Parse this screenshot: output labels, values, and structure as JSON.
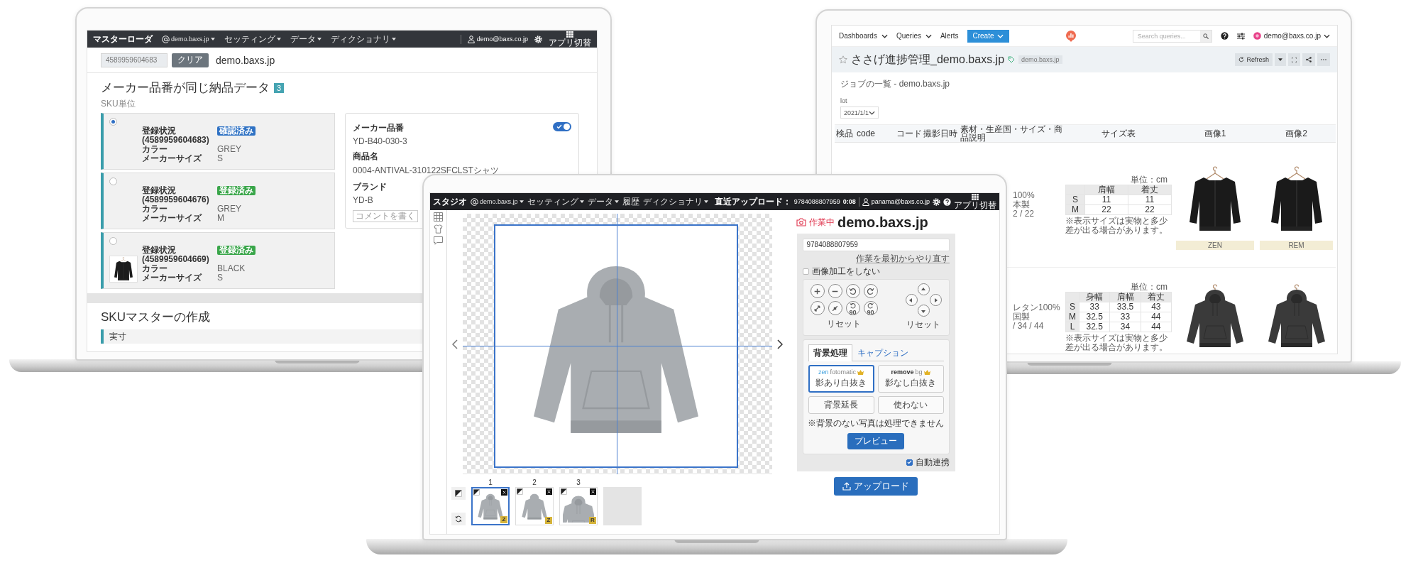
{
  "left_laptop": {
    "nav": {
      "app_name": "マスターローダ",
      "menus": [
        {
          "label": "demo.baxs.jp",
          "kind": "domain"
        },
        {
          "label": "セッティング",
          "kind": "menu"
        },
        {
          "label": "データ",
          "kind": "menu"
        },
        {
          "label": "ディクショナリ",
          "kind": "menu"
        }
      ],
      "user": "demo@baxs.co.jp",
      "apps_label": "アプリ切替"
    },
    "search": {
      "value": "4589959604683",
      "clear_button": "クリア",
      "domain": "demo.baxs.jp"
    },
    "heading": "メーカー品番が同じ納品データ",
    "count": "3",
    "subheading": "SKU単位",
    "sku_cards": [
      {
        "selected": true,
        "photo": false,
        "status_label": "登録状況",
        "code": "(4589959604683)",
        "badge": {
          "text": "確認済み",
          "color": "#2f72c4"
        },
        "attributes": [
          {
            "label": "カラー",
            "value": "GREY"
          },
          {
            "label": "メーカーサイズ",
            "value": "S"
          }
        ]
      },
      {
        "selected": false,
        "photo": false,
        "status_label": "登録状況",
        "code": "(4589959604676)",
        "badge": {
          "text": "登録済み",
          "color": "#3aa64a"
        },
        "attributes": [
          {
            "label": "カラー",
            "value": "GREY"
          },
          {
            "label": "メーカーサイズ",
            "value": "M"
          }
        ]
      },
      {
        "selected": false,
        "photo": true,
        "status_label": "登録状況",
        "code": "(4589959604669)",
        "badge": {
          "text": "登録済み",
          "color": "#3aa64a"
        },
        "attributes": [
          {
            "label": "カラー",
            "value": "BLACK"
          },
          {
            "label": "メーカーサイズ",
            "value": "S"
          }
        ]
      }
    ],
    "detail": {
      "fields": [
        {
          "label": "メーカー品番",
          "value": "YD-B40-030-3"
        },
        {
          "label": "商品名",
          "value": "0004-ANTIVAL-310122SFCLSTシャツ"
        },
        {
          "label": "ブランド",
          "value": "YD-B"
        }
      ],
      "toggle_on": true,
      "comment_placeholder": "コメントを書く"
    },
    "section_title": "SKUマスターの作成",
    "panel_title": "実寸"
  },
  "center_laptop": {
    "nav": {
      "app_name": "スタジオ",
      "menus": [
        {
          "label": "demo.baxs.jp",
          "kind": "domain"
        },
        {
          "label": "セッティング",
          "kind": "menu"
        },
        {
          "label": "データ",
          "kind": "menu"
        },
        {
          "label": "履歴",
          "kind": "link"
        },
        {
          "label": "ディクショナリ",
          "kind": "menu"
        }
      ],
      "recent_label": "直近アップロード：",
      "recent_code": "9784088807959",
      "recent_time": "0:08",
      "user": "panama@baxs.co.jp",
      "apps_label": "アプリ切替"
    },
    "thumbnails": [
      {
        "number": "1",
        "selected": true,
        "tag": "Z",
        "kind": "front"
      },
      {
        "number": "2",
        "selected": false,
        "tag": "Z",
        "kind": "back"
      },
      {
        "number": "3",
        "selected": false,
        "tag": "R",
        "kind": "closeup"
      }
    ],
    "status": "作業中",
    "title": "demo.baxs.jp",
    "code_field": {
      "value": "9784088807959"
    },
    "restart_link": "作業を最初からやり直す",
    "skip_processing": {
      "label": "画像加工をしない",
      "checked": false
    },
    "transform_buttons": [
      {
        "kind": "zoom-in"
      },
      {
        "kind": "zoom-out"
      },
      {
        "kind": "rotate-left"
      },
      {
        "kind": "rotate-right"
      },
      {
        "kind": "expand"
      },
      {
        "kind": "shrink"
      },
      {
        "kind": "rotate-left",
        "text": "90"
      },
      {
        "kind": "rotate-right",
        "text": "90"
      }
    ],
    "reset_labels": [
      "リセット",
      "リセット"
    ],
    "tabs": [
      {
        "label": "背景処理",
        "selected": true
      },
      {
        "label": "キャプション",
        "selected": false
      }
    ],
    "options": [
      {
        "logo": [
          "zen",
          "fotomatic"
        ],
        "premium": true,
        "label": "影あり白抜き",
        "selected": true
      },
      {
        "logo": [
          "remove",
          "bg"
        ],
        "premium": true,
        "label": "影なし白抜き",
        "selected": false
      },
      {
        "label": "背景延長",
        "selected": false
      },
      {
        "label": "使わない",
        "selected": false
      }
    ],
    "note": "※背景のない写真は処理できません",
    "preview_button": "プレビュー",
    "auto_link": {
      "label": "自動連携",
      "checked": true
    },
    "upload_button": "アップロード"
  },
  "right_laptop": {
    "nav": {
      "menus": [
        {
          "label": "Dashboards",
          "kind": "dropdown"
        },
        {
          "label": "Queries",
          "kind": "dropdown"
        },
        {
          "label": "Alerts",
          "kind": "link"
        }
      ],
      "create_button": "Create",
      "search_placeholder": "Search queries...",
      "user": "demo@baxs.co.jp"
    },
    "dashboard": {
      "title": "ささげ進捗管理_demo.baxs.jp",
      "favorite": false,
      "tag": "demo.baxs.jp",
      "refresh_button": "Refresh"
    },
    "widget": {
      "title": "ジョブの一覧 - demo.baxs.jp",
      "parameter": {
        "label": "lot",
        "value": "2021/1/1"
      },
      "table": {
        "columns": [
          "検品",
          "code",
          "コード",
          "撮影日時",
          "素材・生産国・サイズ・商品説明",
          "サイズ表",
          "画像1",
          "画像2"
        ],
        "rows": [
          {
            "description": [
              "100%",
              "本製",
              "2 / 22"
            ],
            "size_chart": {
              "unit": "単位：cm",
              "columns": [
                "",
                "肩幅",
                "着丈"
              ],
              "rows": [
                [
                  "S",
                  "11",
                  "11"
                ],
                [
                  "M",
                  "22",
                  "22"
                ]
              ],
              "note": "※表示サイズは実物と多少差が出る場合があります。"
            },
            "images": [
              {
                "kind": "jacket",
                "caption": "ZEN"
              },
              {
                "kind": "jacket",
                "caption": "REM"
              }
            ]
          },
          {
            "description": [
              "レタン100%",
              "国製",
              "/ 34 / 44"
            ],
            "size_chart": {
              "unit": "単位：cm",
              "columns": [
                "",
                "身幅",
                "肩幅",
                "着丈"
              ],
              "rows": [
                [
                  "S",
                  "33",
                  "33.5",
                  "43"
                ],
                [
                  "M",
                  "32.5",
                  "33",
                  "44"
                ],
                [
                  "L",
                  "32.5",
                  "34",
                  "44"
                ]
              ],
              "note": "※表示サイズは実物と多少差が出る場合があります。"
            },
            "images": [
              {
                "kind": "hoodie"
              },
              {
                "kind": "hoodie"
              }
            ]
          }
        ]
      }
    }
  }
}
